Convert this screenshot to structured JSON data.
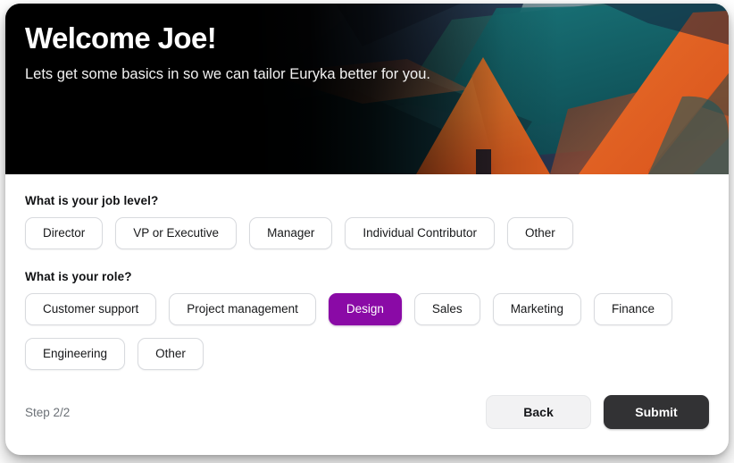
{
  "hero": {
    "title": "Welcome Joe!",
    "subtitle": "Lets get some basics in so we can tailor Euryka better for you.",
    "artwork_name": "abstract-mountain-pyramid-artwork",
    "colors": {
      "background": "#050505",
      "orange": "#E8762C",
      "orange_dark": "#D8581F",
      "teal": "#12656B",
      "teal_dark": "#0E4850",
      "blue_dark": "#1B2340",
      "sky": "#8FA3A8",
      "doorway": "#2A2026"
    }
  },
  "form": {
    "job_level": {
      "question": "What is your job level?",
      "options": [
        {
          "label": "Director",
          "selected": false
        },
        {
          "label": "VP or Executive",
          "selected": false
        },
        {
          "label": "Manager",
          "selected": false
        },
        {
          "label": "Individual Contributor",
          "selected": false
        },
        {
          "label": "Other",
          "selected": false
        }
      ]
    },
    "role": {
      "question": "What is your role?",
      "options": [
        {
          "label": "Customer support",
          "selected": false
        },
        {
          "label": "Project management",
          "selected": false
        },
        {
          "label": "Design",
          "selected": true
        },
        {
          "label": "Sales",
          "selected": false
        },
        {
          "label": "Marketing",
          "selected": false
        },
        {
          "label": "Finance",
          "selected": false
        },
        {
          "label": "Engineering",
          "selected": false
        },
        {
          "label": "Other",
          "selected": false
        }
      ]
    }
  },
  "footer": {
    "step": "Step 2/2",
    "back_label": "Back",
    "submit_label": "Submit"
  },
  "theme": {
    "accent": "#8A0AA6",
    "submit_bg": "#323234",
    "back_bg": "#F2F2F3",
    "chip_border": "#D8DADE",
    "text_primary": "#111214",
    "text_muted": "#6B7076"
  }
}
